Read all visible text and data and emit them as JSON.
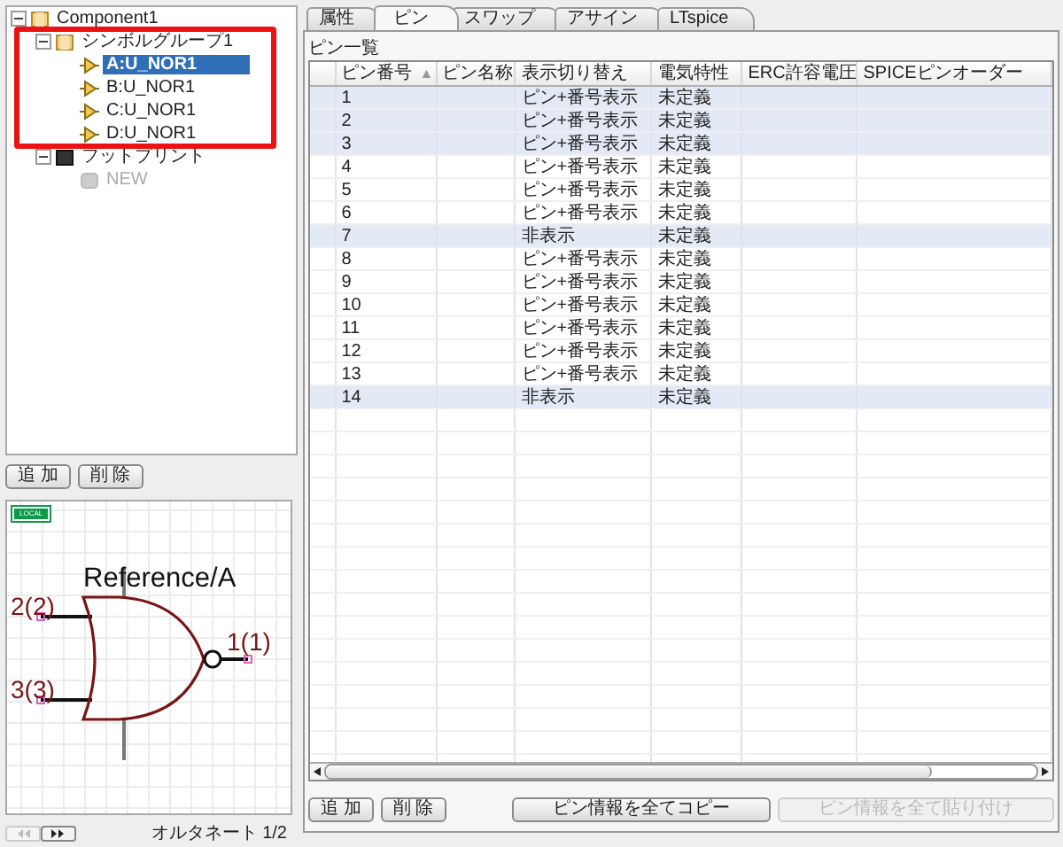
{
  "tree": [
    {
      "label": "Component1",
      "kind": "component",
      "expanded": true,
      "selected": false,
      "children": [
        {
          "label": "シンボルグループ1",
          "kind": "group",
          "expanded": true,
          "selected": false,
          "children": [
            {
              "label": "A:U_NOR1",
              "kind": "symbol",
              "selected": true
            },
            {
              "label": "B:U_NOR1",
              "kind": "symbol",
              "selected": false
            },
            {
              "label": "C:U_NOR1",
              "kind": "symbol",
              "selected": false
            },
            {
              "label": "D:U_NOR1",
              "kind": "symbol",
              "selected": false
            }
          ]
        },
        {
          "label": "フットプリント",
          "kind": "footprint",
          "expanded": true,
          "selected": false,
          "children": [
            {
              "label": "NEW",
              "kind": "new",
              "selected": false
            }
          ]
        }
      ]
    }
  ],
  "tree_buttons": [
    "追 加",
    "削 除"
  ],
  "symbol_preview": {
    "badge": "LOCAL",
    "reference": "Reference/A",
    "pin_labels": [
      "2(2)",
      "3(3)",
      "1(1)"
    ]
  },
  "alternate": {
    "prev_disabled": true,
    "next_disabled": false,
    "label": "オルタネート 1/2"
  },
  "tabs": [
    {
      "label": "属性",
      "selected": false
    },
    {
      "label": "ピン",
      "selected": true
    },
    {
      "label": "スワップ",
      "selected": false
    },
    {
      "label": "アサイン",
      "selected": false
    },
    {
      "label": "LTspice",
      "selected": false
    }
  ],
  "pin_list": {
    "title": "ピン一覧",
    "columns": [
      {
        "label": "ピン番号",
        "sort": "▲"
      },
      {
        "label": "ピン名称"
      },
      {
        "label": "表示切り替え"
      },
      {
        "label": "電気特性"
      },
      {
        "label": "ERC許容電圧"
      },
      {
        "label": "SPICEピンオーダー"
      }
    ],
    "rows": [
      {
        "cells": [
          "1",
          "",
          "ピン+番号表示",
          "未定義",
          "",
          ""
        ],
        "selected": true
      },
      {
        "cells": [
          "2",
          "",
          "ピン+番号表示",
          "未定義",
          "",
          ""
        ],
        "selected": true
      },
      {
        "cells": [
          "3",
          "",
          "ピン+番号表示",
          "未定義",
          "",
          ""
        ],
        "selected": true
      },
      {
        "cells": [
          "4",
          "",
          "ピン+番号表示",
          "未定義",
          "",
          ""
        ],
        "selected": false
      },
      {
        "cells": [
          "5",
          "",
          "ピン+番号表示",
          "未定義",
          "",
          ""
        ],
        "selected": false
      },
      {
        "cells": [
          "6",
          "",
          "ピン+番号表示",
          "未定義",
          "",
          ""
        ],
        "selected": false
      },
      {
        "cells": [
          "7",
          "",
          "非表示",
          "未定義",
          "",
          ""
        ],
        "selected": true
      },
      {
        "cells": [
          "8",
          "",
          "ピン+番号表示",
          "未定義",
          "",
          ""
        ],
        "selected": false
      },
      {
        "cells": [
          "9",
          "",
          "ピン+番号表示",
          "未定義",
          "",
          ""
        ],
        "selected": false
      },
      {
        "cells": [
          "10",
          "",
          "ピン+番号表示",
          "未定義",
          "",
          ""
        ],
        "selected": false
      },
      {
        "cells": [
          "11",
          "",
          "ピン+番号表示",
          "未定義",
          "",
          ""
        ],
        "selected": false
      },
      {
        "cells": [
          "12",
          "",
          "ピン+番号表示",
          "未定義",
          "",
          ""
        ],
        "selected": false
      },
      {
        "cells": [
          "13",
          "",
          "ピン+番号表示",
          "未定義",
          "",
          ""
        ],
        "selected": false
      },
      {
        "cells": [
          "14",
          "",
          "非表示",
          "未定義",
          "",
          ""
        ],
        "selected": true
      }
    ]
  },
  "pin_buttons": [
    {
      "label": "追 加",
      "disabled": false
    },
    {
      "label": "削 除",
      "disabled": false
    },
    {
      "label": "ピン情報を全てコピー",
      "disabled": false
    },
    {
      "label": "ピン情報を全て貼り付け",
      "disabled": true
    }
  ]
}
